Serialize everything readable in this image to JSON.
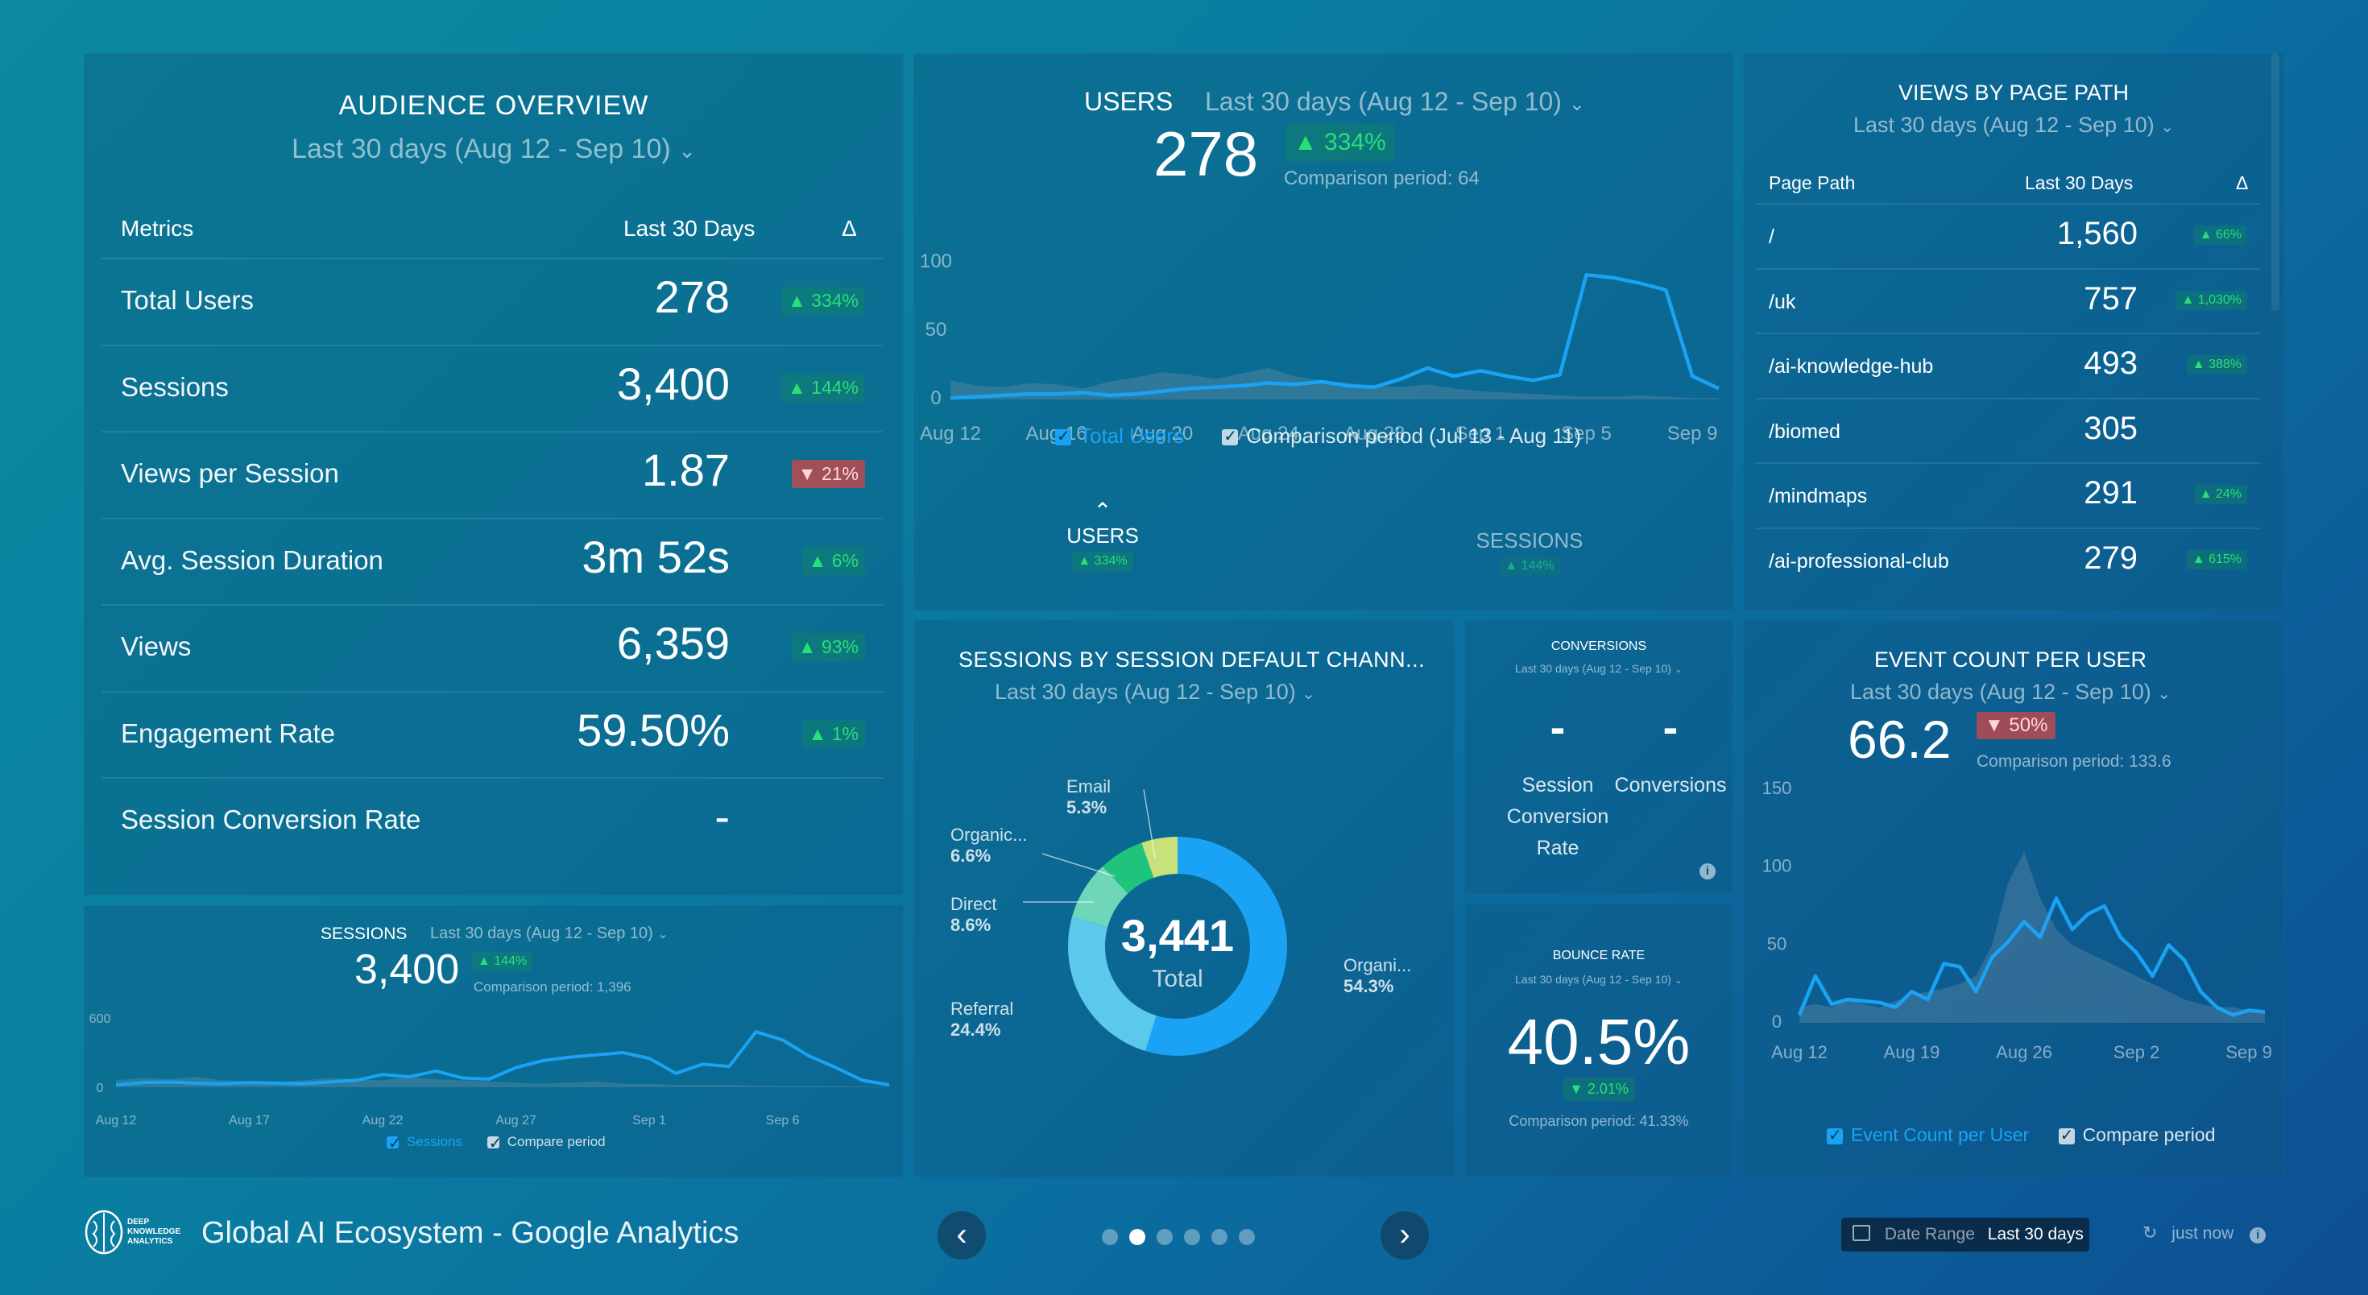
{
  "audience": {
    "title": "AUDIENCE OVERVIEW",
    "range": "Last 30 days (Aug 12 - Sep 10)",
    "col_metrics": "Metrics",
    "col_period": "Last 30 Days",
    "col_delta": "Δ",
    "rows": [
      {
        "label": "Total Users",
        "value": "278",
        "delta": "▲ 334%",
        "dir": "up"
      },
      {
        "label": "Sessions",
        "value": "3,400",
        "delta": "▲ 144%",
        "dir": "up"
      },
      {
        "label": "Views per Session",
        "value": "1.87",
        "delta": "▼ 21%",
        "dir": "down"
      },
      {
        "label": "Avg. Session Duration",
        "value": "3m 52s",
        "delta": "▲ 6%",
        "dir": "up"
      },
      {
        "label": "Views",
        "value": "6,359",
        "delta": "▲ 93%",
        "dir": "up"
      },
      {
        "label": "Engagement Rate",
        "value": "59.50%",
        "delta": "▲ 1%",
        "dir": "up"
      },
      {
        "label": "Session Conversion Rate",
        "value": "-",
        "delta": "",
        "dir": ""
      }
    ]
  },
  "users": {
    "title": "USERS",
    "range": "Last 30 days (Aug 12 - Sep 10)",
    "value": "278",
    "delta": "▲ 334%",
    "comparison": "Comparison period: 64",
    "legend_main": "Total Users",
    "legend_compare": "Comparison period (Jul 13 - Aug 11)",
    "tab_users": "USERS",
    "tab_users_delta": "▲ 334%",
    "tab_sessions": "SESSIONS",
    "tab_sessions_delta": "▲ 144%"
  },
  "pages": {
    "title": "VIEWS BY PAGE PATH",
    "range": "Last 30 days (Aug 12 - Sep 10)",
    "col_path": "Page Path",
    "col_period": "Last 30 Days",
    "col_delta": "Δ",
    "rows": [
      {
        "path": "/",
        "value": "1,560",
        "delta": "▲ 66%"
      },
      {
        "path": "/uk",
        "value": "757",
        "delta": "▲ 1,030%"
      },
      {
        "path": "/ai-knowledge-hub",
        "value": "493",
        "delta": "▲ 388%"
      },
      {
        "path": "/biomed",
        "value": "305",
        "delta": ""
      },
      {
        "path": "/mindmaps",
        "value": "291",
        "delta": "▲ 24%"
      },
      {
        "path": "/ai-professional-club",
        "value": "279",
        "delta": "▲ 615%"
      }
    ]
  },
  "sessions_small": {
    "title": "SESSIONS",
    "range": "Last 30 days (Aug 12 - Sep 10)",
    "value": "3,400",
    "delta": "▲ 144%",
    "comparison": "Comparison period: 1,396",
    "legend_main": "Sessions",
    "legend_compare": "Compare period"
  },
  "channels": {
    "title": "SESSIONS BY SESSION DEFAULT CHANN...",
    "range": "Last 30 days (Aug 12 - Sep 10)",
    "total": "3,441",
    "total_label": "Total",
    "labels": [
      {
        "name": "Email",
        "pct": "5.3%"
      },
      {
        "name": "Organic...",
        "pct": "6.6%"
      },
      {
        "name": "Direct",
        "pct": "8.6%"
      },
      {
        "name": "Referral",
        "pct": "24.4%"
      },
      {
        "name": "Organi...",
        "pct": "54.3%"
      }
    ]
  },
  "conversions": {
    "title": "CONVERSIONS",
    "range": "Last 30 days (Aug 12 - Sep 10)",
    "col1_value": "-",
    "col1_label": "Session Conversion Rate",
    "col2_value": "-",
    "col2_label": "Conversions"
  },
  "bounce": {
    "title": "BOUNCE RATE",
    "range": "Last 30 days (Aug 12 - Sep 10)",
    "value": "40.5%",
    "delta": "▼ 2.01%",
    "comparison": "Comparison period: 41.33%"
  },
  "events": {
    "title": "EVENT COUNT PER USER",
    "range": "Last 30 days (Aug 12 - Sep 10)",
    "value": "66.2",
    "delta": "▼ 50%",
    "comparison": "Comparison period: 133.6",
    "legend_main": "Event Count per User",
    "legend_compare": "Compare period"
  },
  "footer": {
    "title": "Global AI Ecosystem - Google Analytics",
    "logo_text": "DEEP KNOWLEDGE ANALYTICS",
    "date_range_label": "Date Range",
    "date_range_value": "Last 30 days",
    "refresh": "just now"
  },
  "colors": {
    "accent": "#1aa3f5",
    "positive": "#27e07a",
    "negative": "#d84a4a"
  },
  "chart_data": [
    {
      "type": "area",
      "name": "users",
      "x": [
        "Aug 12",
        "Aug 13",
        "Aug 14",
        "Aug 15",
        "Aug 16",
        "Aug 17",
        "Aug 18",
        "Aug 19",
        "Aug 20",
        "Aug 21",
        "Aug 22",
        "Aug 23",
        "Aug 24",
        "Aug 25",
        "Aug 26",
        "Aug 27",
        "Aug 28",
        "Aug 29",
        "Aug 30",
        "Aug 31",
        "Sep 1",
        "Sep 2",
        "Sep 3",
        "Sep 4",
        "Sep 5",
        "Sep 6",
        "Sep 7",
        "Sep 8",
        "Sep 9",
        "Sep 10"
      ],
      "xticks": [
        "Aug 12",
        "Aug 16",
        "Aug 20",
        "Aug 24",
        "Aug 28",
        "Sep 1",
        "Sep 5",
        "Sep 9"
      ],
      "yticks": [
        0,
        50,
        100
      ],
      "ylim": [
        0,
        100
      ],
      "series": [
        {
          "name": "Total Users",
          "values": [
            1,
            2,
            3,
            4,
            4,
            5,
            3,
            4,
            6,
            8,
            9,
            10,
            12,
            11,
            13,
            10,
            9,
            15,
            23,
            17,
            21,
            17,
            14,
            18,
            91,
            89,
            85,
            80,
            17,
            8
          ]
        },
        {
          "name": "Comparison period (Jul 13 - Aug 11)",
          "values": [
            14,
            10,
            9,
            12,
            11,
            8,
            13,
            16,
            20,
            18,
            15,
            19,
            23,
            17,
            14,
            12,
            10,
            9,
            11,
            8,
            6,
            5,
            4,
            3,
            2,
            2,
            3,
            2,
            1,
            1
          ]
        }
      ]
    },
    {
      "type": "area",
      "name": "sessions",
      "x": [
        "Aug 12",
        "Aug 13",
        "Aug 14",
        "Aug 15",
        "Aug 16",
        "Aug 17",
        "Aug 18",
        "Aug 19",
        "Aug 20",
        "Aug 21",
        "Aug 22",
        "Aug 23",
        "Aug 24",
        "Aug 25",
        "Aug 26",
        "Aug 27",
        "Aug 28",
        "Aug 29",
        "Aug 30",
        "Aug 31",
        "Sep 1",
        "Sep 2",
        "Sep 3",
        "Sep 4",
        "Sep 5",
        "Sep 6",
        "Sep 7",
        "Sep 8",
        "Sep 9",
        "Sep 10"
      ],
      "xticks": [
        "Aug 12",
        "Aug 17",
        "Aug 22",
        "Aug 27",
        "Sep 1",
        "Sep 6"
      ],
      "yticks": [
        0,
        600
      ],
      "ylim": [
        0,
        600
      ],
      "series": [
        {
          "name": "Sessions",
          "values": [
            20,
            40,
            45,
            35,
            30,
            40,
            35,
            30,
            45,
            60,
            110,
            90,
            140,
            80,
            70,
            170,
            230,
            260,
            280,
            300,
            250,
            120,
            200,
            180,
            480,
            410,
            270,
            170,
            60,
            20
          ]
        },
        {
          "name": "Compare period",
          "values": [
            60,
            80,
            70,
            90,
            60,
            50,
            40,
            60,
            80,
            70,
            60,
            90,
            70,
            60,
            50,
            40,
            30,
            40,
            50,
            30,
            30,
            20,
            20,
            20,
            15,
            10,
            10,
            10,
            5,
            5
          ]
        }
      ]
    },
    {
      "type": "pie",
      "name": "channels",
      "categories": [
        "Organic Search",
        "Referral",
        "Direct",
        "Organic Social",
        "Email"
      ],
      "values": [
        54.3,
        24.4,
        8.6,
        6.6,
        5.3
      ],
      "total": 3441
    },
    {
      "type": "area",
      "name": "events",
      "x": [
        "Aug 12",
        "Aug 13",
        "Aug 14",
        "Aug 15",
        "Aug 16",
        "Aug 17",
        "Aug 18",
        "Aug 19",
        "Aug 20",
        "Aug 21",
        "Aug 22",
        "Aug 23",
        "Aug 24",
        "Aug 25",
        "Aug 26",
        "Aug 27",
        "Aug 28",
        "Aug 29",
        "Aug 30",
        "Aug 31",
        "Sep 1",
        "Sep 2",
        "Sep 3",
        "Sep 4",
        "Sep 5",
        "Sep 6",
        "Sep 7",
        "Sep 8",
        "Sep 9",
        "Sep 10"
      ],
      "xticks": [
        "Aug 12",
        "Aug 19",
        "Aug 26",
        "Sep 2",
        "Sep 9"
      ],
      "yticks": [
        0,
        50,
        100,
        150
      ],
      "ylim": [
        0,
        150
      ],
      "series": [
        {
          "name": "Event Count per User",
          "values": [
            5,
            30,
            12,
            15,
            14,
            13,
            10,
            20,
            15,
            38,
            36,
            20,
            42,
            52,
            65,
            55,
            80,
            60,
            70,
            75,
            55,
            45,
            30,
            50,
            40,
            20,
            10,
            5,
            8,
            7
          ]
        },
        {
          "name": "Compare period",
          "values": [
            10,
            12,
            10,
            15,
            12,
            10,
            14,
            18,
            20,
            22,
            25,
            30,
            50,
            90,
            110,
            80,
            60,
            50,
            45,
            40,
            35,
            30,
            25,
            20,
            15,
            12,
            10,
            10,
            8,
            8
          ]
        }
      ]
    }
  ]
}
